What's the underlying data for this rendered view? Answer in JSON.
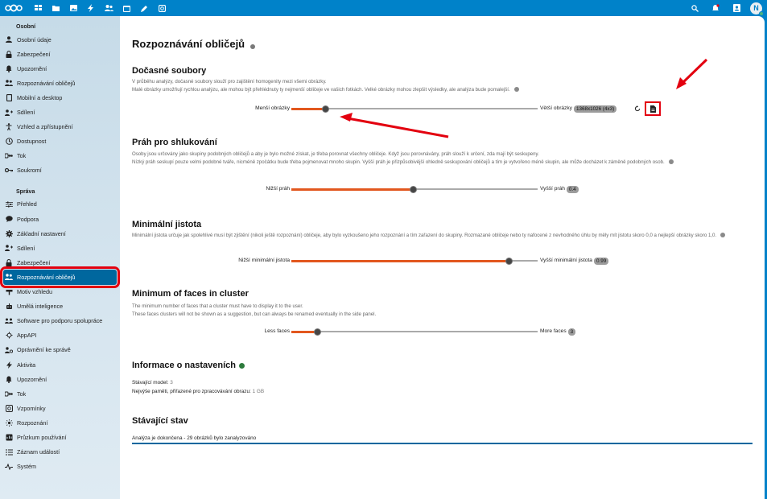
{
  "header": {
    "apps": [
      "dashboard-icon",
      "files-icon",
      "photos-icon",
      "activity-icon",
      "contacts-icon",
      "calendar-icon",
      "notes-icon",
      "memories-icon"
    ],
    "avatar_initial": "N"
  },
  "sidebar": {
    "personal_title": "Osobní",
    "personal": [
      {
        "label": "Osobní údaje",
        "icon": "person-icon"
      },
      {
        "label": "Zabezpečení",
        "icon": "lock-icon"
      },
      {
        "label": "Upozornění",
        "icon": "bell-icon"
      },
      {
        "label": "Rozpoznávání obličejů",
        "icon": "faces-icon"
      },
      {
        "label": "Mobilní a desktop",
        "icon": "phone-icon"
      },
      {
        "label": "Sdílení",
        "icon": "share-icon"
      },
      {
        "label": "Vzhled a zpřístupnění",
        "icon": "accessibility-icon"
      },
      {
        "label": "Dostupnost",
        "icon": "clock-icon"
      },
      {
        "label": "Tok",
        "icon": "flow-icon"
      },
      {
        "label": "Soukromí",
        "icon": "key-icon"
      }
    ],
    "admin_title": "Správa",
    "admin": [
      {
        "label": "Přehled",
        "icon": "sliders-icon"
      },
      {
        "label": "Podpora",
        "icon": "chat-icon"
      },
      {
        "label": "Základní nastavení",
        "icon": "gear-icon"
      },
      {
        "label": "Sdílení",
        "icon": "share-icon"
      },
      {
        "label": "Zabezpečení",
        "icon": "lock-icon"
      },
      {
        "label": "Rozpoznávání obličejů",
        "icon": "faces-icon"
      },
      {
        "label": "Motiv vzhledu",
        "icon": "brush-icon"
      },
      {
        "label": "Umělá inteligence",
        "icon": "robot-icon"
      },
      {
        "label": "Software pro podporu spolupráce",
        "icon": "group-icon"
      },
      {
        "label": "AppAPI",
        "icon": "gear-small-icon"
      },
      {
        "label": "Oprávnění ke správě",
        "icon": "admin-users-icon"
      },
      {
        "label": "Aktivita",
        "icon": "activity-icon"
      },
      {
        "label": "Upozornění",
        "icon": "bell-icon"
      },
      {
        "label": "Tok",
        "icon": "flow-icon"
      },
      {
        "label": "Vzpomínky",
        "icon": "memories-icon"
      },
      {
        "label": "Rozpoznání",
        "icon": "sun-icon"
      },
      {
        "label": "Průzkum používání",
        "icon": "survey-icon"
      },
      {
        "label": "Záznam událostí",
        "icon": "list-icon"
      },
      {
        "label": "Systém",
        "icon": "pulse-icon"
      }
    ]
  },
  "main": {
    "title": "Rozpoznávání obličejů",
    "temp": {
      "heading": "Dočasné soubory",
      "desc1": "V průběhu analýzy, dočasné soubory slouží pro zajištění homogenity mezi všemi obrázky.",
      "desc2": "Malé obrázky umožňují rychlou analýzu, ale mohou být přehlédnuty ty nejmenší obličeje ve vašich fotkách. Velké obrázky mohou zlepšit výsledky, ale analýza bude pomalejší.",
      "left_label": "Menší obrázky",
      "right_label": "Větší obrázky",
      "value_badge": "1368x1026 (4x3)",
      "value": 0.1
    },
    "threshold": {
      "heading": "Práh pro shlukování",
      "desc1": "Osoby jsou určovány jako skupiny podobných obličejů a aby je bylo možné získat, je třeba porovnat všechny obličeje. Když jsou porovnávány, práh slouží k určení, zda mají být seskupeny.",
      "desc2": "Nízký práh seskupí pouze velmi podobné tváře, nicméně zpočátku bude třeba pojmenovat mnoho skupin. Vyšší práh je přizpůsobivější ohledně seskupování obličejů a tím je vytvořeno méně skupin, ale může docházet k záměně podobných osob.",
      "left_label": "Nižší práh",
      "right_label": "Vyšší práh",
      "value_badge": "0.4",
      "value": 0.4
    },
    "confidence": {
      "heading": "Minimální jistota",
      "desc1": "Minimální jistota určuje jak spolehlivé musí být zjištění (nikoli ještě rozpoznání) obličeje, aby bylo vyzkoušeno jeho rozpoznání a tím zařazení do skupiny. Rozmazané obličeje nebo ty nafocené z nevhodného úhlu by měly mít jistotu skoro 0,0 a nejlepší obrázky skoro 1,0.",
      "left_label": "Nižší minimální jistota",
      "right_label": "Vyšší minimální jistota",
      "value_badge": "0.99",
      "value": 0.88
    },
    "faces": {
      "heading": "Minimum of faces in cluster",
      "desc1": "The minimum number of faces that a cluster must have to display it to the user.",
      "desc2": "These faces clusters will not be shown as a suggestion, but can always be renamed eventually in the side panel.",
      "left_label": "Less faces",
      "right_label": "More faces",
      "value_badge": "3",
      "value": 0.1
    },
    "info": {
      "heading": "Informace o nastaveních",
      "model_label": "Stávající model:",
      "model_value": "3",
      "memory_label": "Nejvýše paměti, přiřazené pro zpracovávání obrazu:",
      "memory_value": "1 GB"
    },
    "status": {
      "heading": "Stávající stav",
      "text": "Analýza je dokončena - 29 obrázků bylo zanalyzováno"
    }
  },
  "colors": {
    "brand": "#0082c9",
    "active": "#00679e",
    "slider_fill": "#e2571e",
    "highlight": "#e3000f"
  }
}
